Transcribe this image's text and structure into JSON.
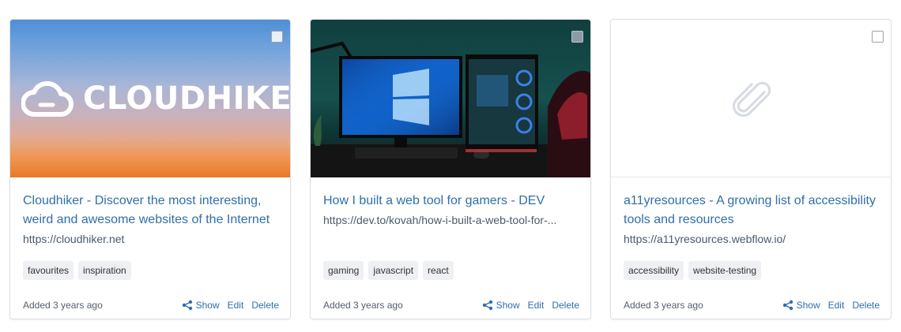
{
  "cards": [
    {
      "brand_text": "CLOUDHIKER",
      "title": "Cloudhiker - Discover the most interesting, weird and awesome websites of the Internet",
      "url": "https://cloudhiker.net",
      "tags": [
        "favourites",
        "inspiration"
      ],
      "added": "Added 3 years ago",
      "actions": {
        "show": "Show",
        "edit": "Edit",
        "delete": "Delete"
      }
    },
    {
      "title": "How I built a web tool for gamers - DEV",
      "url": "https://dev.to/kovah/how-i-built-a-web-tool-for-...",
      "tags": [
        "gaming",
        "javascript",
        "react"
      ],
      "added": "Added 3 years ago",
      "actions": {
        "show": "Show",
        "edit": "Edit",
        "delete": "Delete"
      }
    },
    {
      "title": "a11yresources - A growing list of accessibility tools and resources",
      "url": "https://a11yresources.webflow.io/",
      "tags": [
        "accessibility",
        "website-testing"
      ],
      "added": "Added 3 years ago",
      "actions": {
        "show": "Show",
        "edit": "Edit",
        "delete": "Delete"
      }
    }
  ],
  "icons": {
    "share": "share-icon",
    "select": "checkbox-icon",
    "placeholder": "paperclip-icon",
    "brand": "cloud-logo-icon"
  },
  "colors": {
    "link": "#2f6fa9",
    "tag_bg": "#eef0f3",
    "border": "#dcdfe4"
  }
}
